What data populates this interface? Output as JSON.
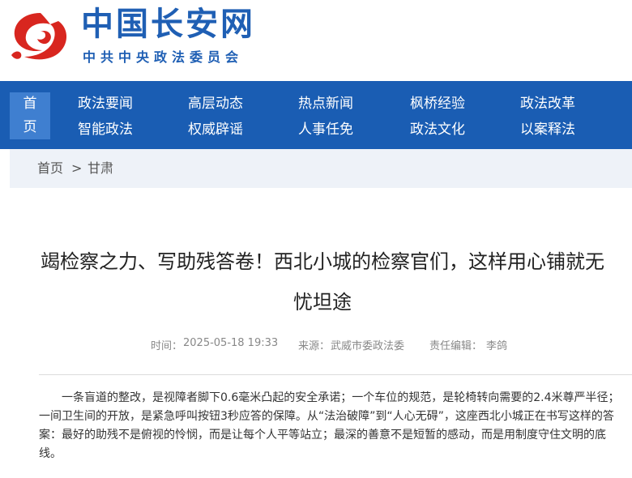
{
  "site": {
    "title": "中国长安网",
    "subtitle": "中共中央政法委员会"
  },
  "nav": {
    "home_line1": "首",
    "home_line2": "页",
    "items": [
      {
        "label": "政法要闻"
      },
      {
        "label": "高层动态"
      },
      {
        "label": "热点新闻"
      },
      {
        "label": "枫桥经验"
      },
      {
        "label": "政法改革"
      },
      {
        "label": "智能政法"
      },
      {
        "label": "权威辟谣"
      },
      {
        "label": "人事任免"
      },
      {
        "label": "政法文化"
      },
      {
        "label": "以案释法"
      }
    ]
  },
  "breadcrumb": {
    "home": "首页",
    "separator": ">",
    "current": "甘肃"
  },
  "article": {
    "title": "竭检察之力、写助残答卷！西北小城的检察官们，这样用心铺就无忧坦途",
    "time_label": "时间：",
    "time": "2025-05-18 19:33",
    "source_label": "来源：",
    "source": "武威市委政法委",
    "editor_label": "责任编辑：",
    "editor": "李鸽",
    "body": "一条盲道的整改，是视障者脚下0.6毫米凸起的安全承诺；一个车位的规范，是轮椅转向需要的2.4米尊严半径；一间卫生间的开放，是紧急呼叫按钮3秒应答的保障。从“法治破障”到“人心无碍”，这座西北小城正在书写这样的答案：最好的助残不是俯视的怜悯，而是让每个人平等站立；最深的善意不是短暂的感动，而是用制度守住文明的底线。"
  },
  "colors": {
    "brand_blue": "#1f5fb4",
    "nav_bg": "#1a5db3",
    "nav_home_bg": "#3f7fd0",
    "logo_red": "#d8261f"
  },
  "icons": {
    "logo": "red-swirl-logo"
  }
}
